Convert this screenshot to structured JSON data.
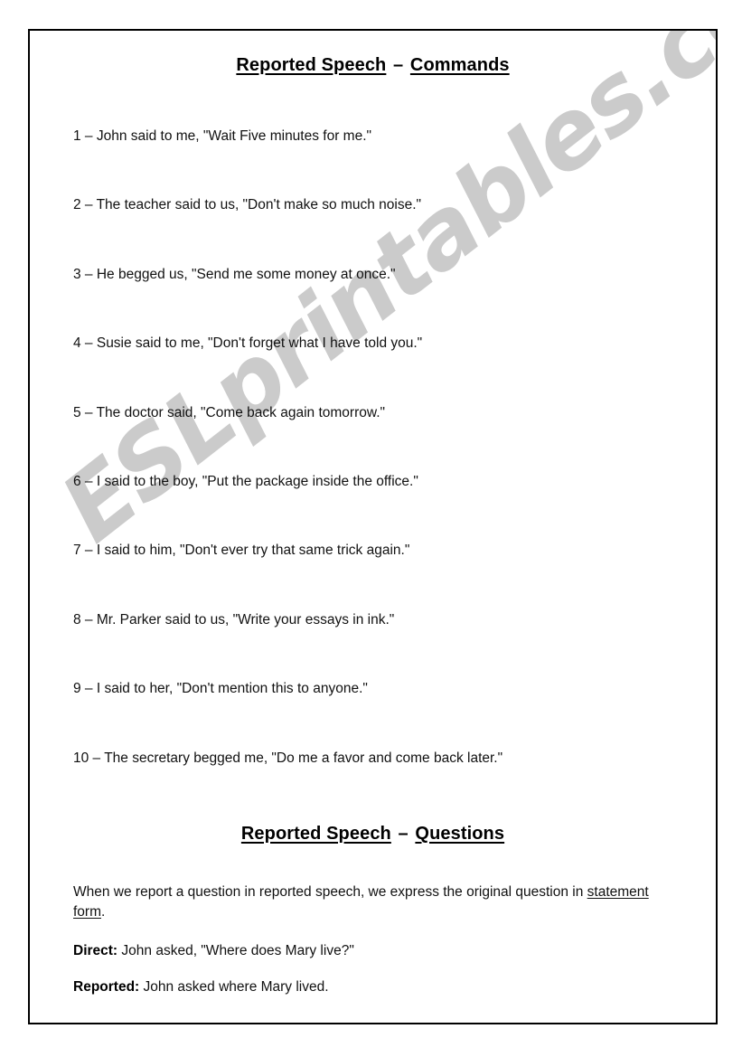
{
  "document": {
    "watermark_text": "ESLprintables.com",
    "watermark_color": "#cbcbcb",
    "border_color": "#000000",
    "text_color": "#111111"
  },
  "headings": {
    "commands": {
      "main": "Reported Speech",
      "dash": " – ",
      "sub": "Commands"
    },
    "questions": {
      "main": "Reported Speech",
      "dash": " – ",
      "sub": "Questions"
    }
  },
  "exercises": [
    "1 – John said to me, \"Wait Five minutes for me.\"",
    "2 – The teacher said to us, \"Don't make so much noise.\"",
    "3 – He begged us, \"Send me some money at once.\"",
    "4 – Susie said to me, \"Don't forget what I have told you.\"",
    "5 – The doctor said, \"Come back again tomorrow.\"",
    "6 – I said to the boy, \"Put the package inside the office.\"",
    "7 – I said to him, \"Don't ever try that same trick again.\"",
    "8 – Mr. Parker said to us, \"Write your essays in ink.\"",
    "9 – I said to her, \"Don't mention this to anyone.\"",
    "10 – The secretary begged me, \"Do me a favor and come back later.\""
  ],
  "explanation": {
    "intro_before": "When we report a question in reported speech, we express the original question in ",
    "intro_underlined": "statement form",
    "intro_after": ".",
    "direct_label": "Direct:",
    "direct_text": " John asked, \"Where does Mary live?\"",
    "reported_label": "Reported:",
    "reported_text": " John asked where Mary lived."
  }
}
